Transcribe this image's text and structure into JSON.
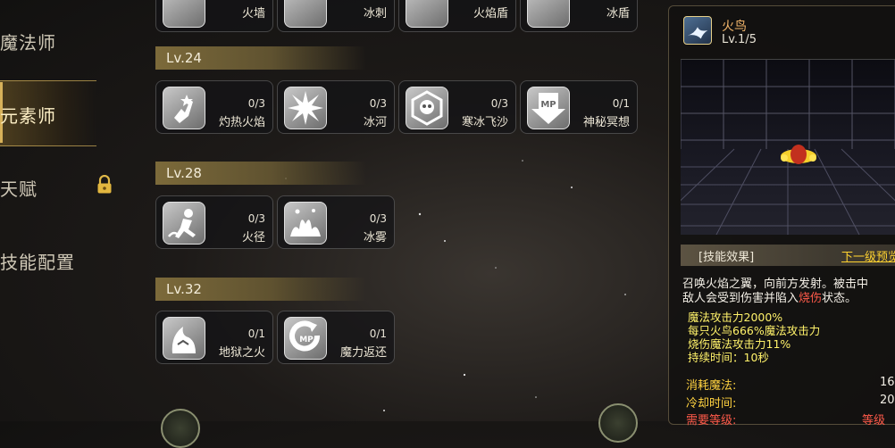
{
  "nav": {
    "items": [
      {
        "label": "魔法师"
      },
      {
        "label": "元素师"
      },
      {
        "label": "天赋"
      },
      {
        "label": "技能配置"
      }
    ]
  },
  "top_row": [
    {
      "name": "火墙"
    },
    {
      "name": "冰刺"
    },
    {
      "name": "火焰盾"
    },
    {
      "name": "冰盾"
    }
  ],
  "levels": [
    {
      "label": "Lv.24",
      "skills": [
        {
          "name": "灼热火焰",
          "count": "0/3",
          "icon": "fire-hand-icon"
        },
        {
          "name": "冰河",
          "count": "0/3",
          "icon": "ice-burst-icon"
        },
        {
          "name": "寒冰飞沙",
          "count": "0/3",
          "icon": "frost-skull-icon"
        },
        {
          "name": "神秘冥想",
          "count": "0/1",
          "icon": "mp-down-icon"
        }
      ]
    },
    {
      "label": "Lv.28",
      "skills": [
        {
          "name": "火径",
          "count": "0/3",
          "icon": "fire-runner-icon"
        },
        {
          "name": "冰雾",
          "count": "0/3",
          "icon": "ice-mist-icon"
        }
      ]
    },
    {
      "label": "Lv.32",
      "skills": [
        {
          "name": "地狱之火",
          "count": "0/1",
          "icon": "hellfire-icon"
        },
        {
          "name": "魔力返还",
          "count": "0/1",
          "icon": "mp-return-icon"
        }
      ]
    }
  ],
  "detail": {
    "title": "火鸟",
    "level": "Lv.1/5",
    "effect_label": "[技能效果]",
    "next_link": "下一级预览",
    "desc_a": "召唤火焰之翼，向前方发射。被击中",
    "desc_b": "敌人会受到伤害并陷入",
    "desc_burn": "烧伤",
    "desc_c": "状态。",
    "stats": [
      "魔法攻击力2000%",
      "每只火鸟666%魔法攻击力",
      "烧伤魔法攻击力11%",
      "持续时间：10秒"
    ],
    "kv": [
      {
        "key": "消耗魔法:",
        "value": "16"
      },
      {
        "key": "冷却时间:",
        "value": "20"
      },
      {
        "key": "需要等级:",
        "value": "等级"
      }
    ]
  },
  "colors": {
    "accent_gold": "#d7b15a",
    "stat_yellow": "#fff26a",
    "burn_red": "#ff5a4a",
    "link_yellow": "#ffd330"
  }
}
